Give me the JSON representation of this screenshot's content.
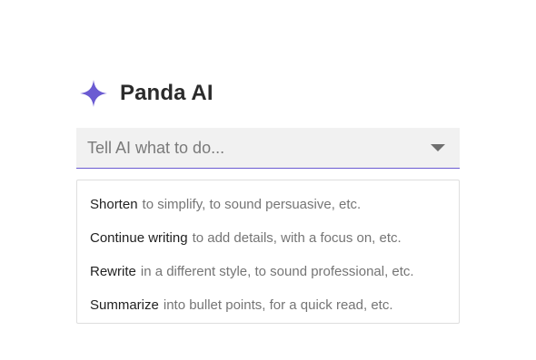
{
  "header": {
    "icon": "sparkle-icon",
    "title": "Panda AI",
    "accent_color": "#6b5bd2"
  },
  "prompt": {
    "placeholder": "Tell AI what to do...",
    "value": ""
  },
  "suggestions": [
    {
      "action": "Shorten",
      "hint": "to simplify, to sound persuasive, etc."
    },
    {
      "action": "Continue writing",
      "hint": "to add details, with a focus on, etc."
    },
    {
      "action": "Rewrite",
      "hint": "in a different style, to sound professional, etc."
    },
    {
      "action": "Summarize",
      "hint": "into bullet points, for a quick read, etc."
    }
  ]
}
